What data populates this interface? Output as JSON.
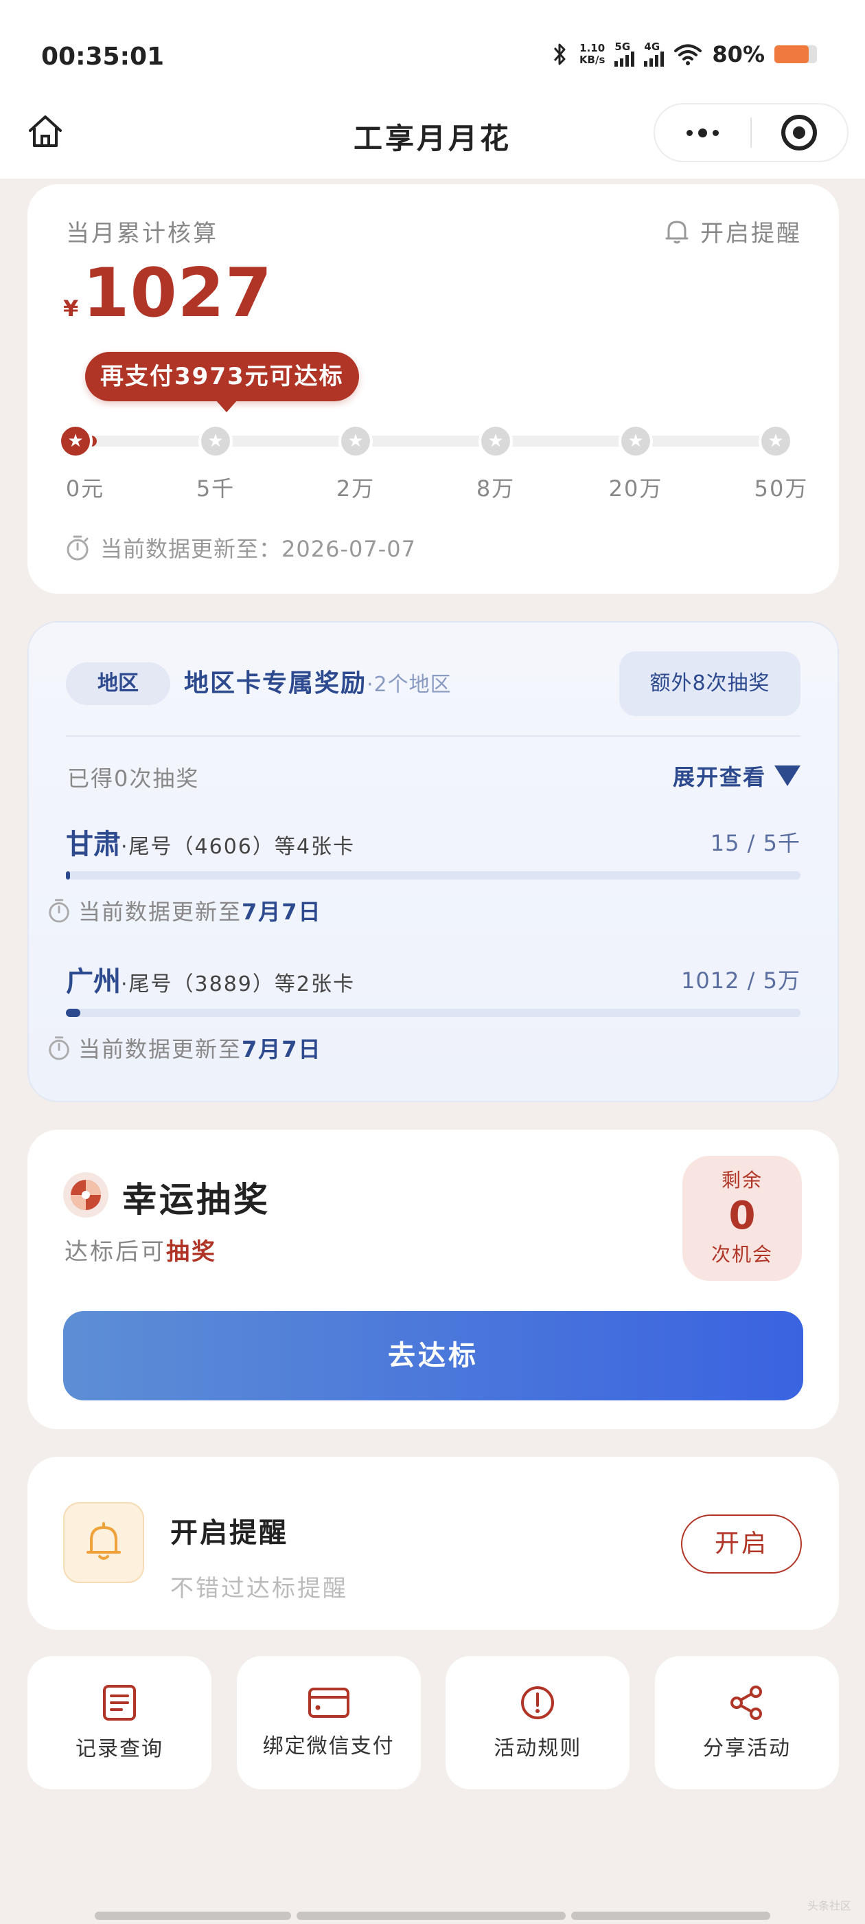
{
  "status_bar": {
    "time": "00:35:01",
    "net_speed_value": "1.10",
    "net_speed_unit": "KB/s",
    "signal1": "5G",
    "signal2": "4G",
    "battery": "80%",
    "battery_level": 0.8
  },
  "nav": {
    "title": "工享月月花",
    "home_icon": "home-icon",
    "more_icon": "more-icon",
    "close_icon": "target-close-icon"
  },
  "summary": {
    "label": "当月累计核算",
    "remind_label": "开启提醒",
    "currency": "¥",
    "amount": "1027",
    "tip": "再支付3973元可达标",
    "milestones": [
      "0元",
      "5千",
      "2万",
      "8万",
      "20万",
      "50万"
    ],
    "progress_fraction": 0.03,
    "update_text": "当前数据更新至：2026-07-07",
    "accent_color": "#b13526"
  },
  "region": {
    "badge": "地区",
    "title": "地区卡专属奖励",
    "title_sub": "·2个地区",
    "extra_button": "额外8次抽奖",
    "got_text": "已得0次抽奖",
    "expand_label": "展开查看",
    "rows": [
      {
        "name": "甘肃",
        "desc": "·尾号（4606）等4张卡",
        "progress": "15 / 5千",
        "progress_fraction": 0.003,
        "update_prefix": "当前数据更新至",
        "update_date": "7月7日"
      },
      {
        "name": "广州",
        "desc": "·尾号（3889）等2张卡",
        "progress": "1012 / 5万",
        "progress_fraction": 0.02,
        "update_prefix": "当前数据更新至",
        "update_date": "7月7日"
      }
    ]
  },
  "lucky": {
    "title": "幸运抽奖",
    "sub_prefix": "达标后可",
    "sub_highlight": "抽奖",
    "remain_top": "剩余",
    "remain_count": "0",
    "remain_bottom": "次机会",
    "go_button": "去达标"
  },
  "reminder": {
    "title": "开启提醒",
    "subtitle": "不错过达标提醒",
    "button": "开启"
  },
  "tiles": [
    {
      "label": "记录查询",
      "icon": "document-list-icon"
    },
    {
      "label": "绑定微信支付",
      "icon": "card-icon"
    },
    {
      "label": "活动规则",
      "icon": "exclamation-circle-icon"
    },
    {
      "label": "分享活动",
      "icon": "share-icon"
    }
  ],
  "watermark": "头条社区"
}
